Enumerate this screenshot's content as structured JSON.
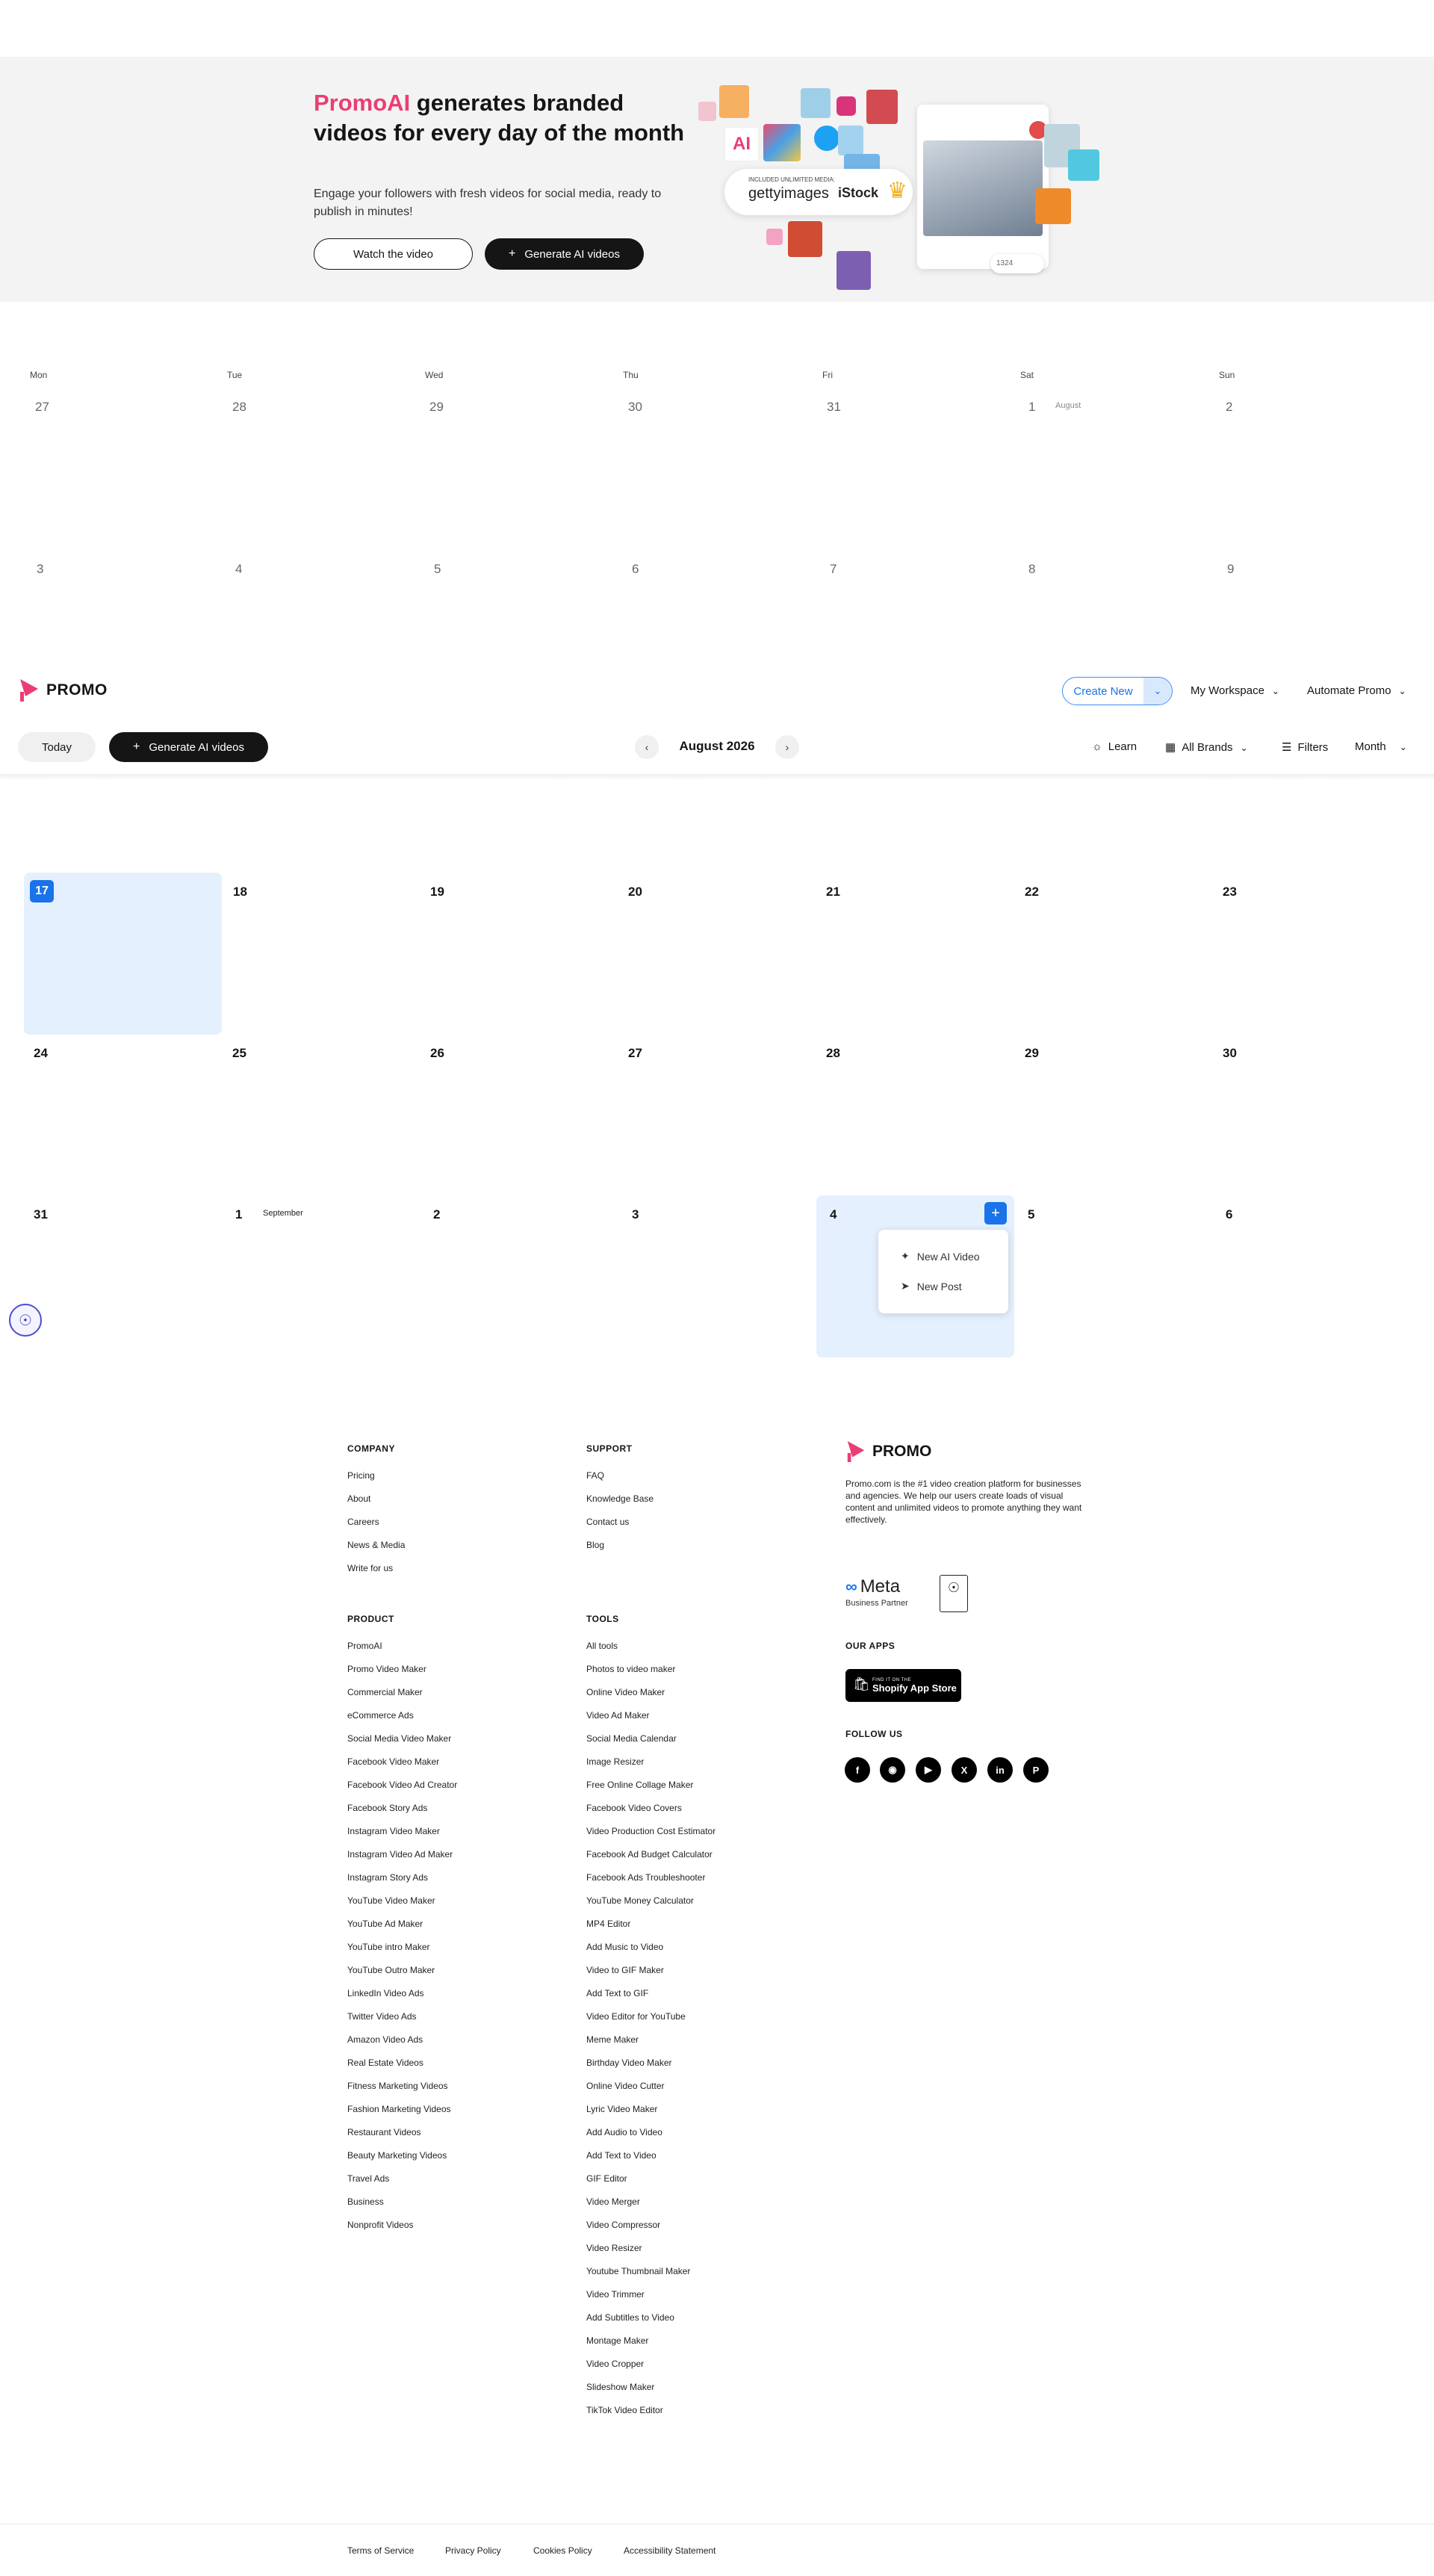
{
  "hero": {
    "title_brand": "PromoAI",
    "title_rest": " generates branded videos for every day of the month",
    "subtitle": "Engage your followers with fresh videos for social media, ready to publish in minutes!",
    "watch_label": "Watch the video",
    "generate_label": "Generate AI videos",
    "collage": {
      "included_label": "INCLUDED UNLIMITED MEDIA:",
      "getty": "gettyimages",
      "istock": "iStock",
      "ai_tile": "AI",
      "likes_count": "1324"
    }
  },
  "prev_calendar": {
    "weekdays": [
      "Mon",
      "Tue",
      "Wed",
      "Thu",
      "Fri",
      "Sat",
      "Sun"
    ],
    "row1": [
      "27",
      "28",
      "29",
      "30",
      "31",
      "1",
      "2"
    ],
    "row2": [
      "3",
      "4",
      "5",
      "6",
      "7",
      "8",
      "9"
    ],
    "month_label": "August"
  },
  "header": {
    "logo": "PROMO",
    "create_new": "Create New",
    "workspace": "My Workspace",
    "automate": "Automate Promo"
  },
  "toolbar": {
    "today": "Today",
    "generate": "Generate AI videos",
    "month_title": "August 2026",
    "learn": "Learn",
    "brands": "All Brands",
    "filters": "Filters",
    "view": "Month"
  },
  "calendar": {
    "row1": [
      "17",
      "18",
      "19",
      "20",
      "21",
      "22",
      "23"
    ],
    "row2": [
      "24",
      "25",
      "26",
      "27",
      "28",
      "29",
      "30"
    ],
    "row3": [
      "31",
      "1",
      "2",
      "3",
      "4",
      "5",
      "6"
    ],
    "september_label": "September",
    "today_date": "17",
    "popup": {
      "new_ai_video": "New AI Video",
      "new_post": "New Post"
    }
  },
  "footer": {
    "company_heading": "COMPANY",
    "company": [
      "Pricing",
      "About",
      "Careers",
      "News & Media",
      "Write for us"
    ],
    "support_heading": "SUPPORT",
    "support": [
      "FAQ",
      "Knowledge Base",
      "Contact us",
      "Blog"
    ],
    "product_heading": "PRODUCT",
    "product": [
      "PromoAI",
      "Promo Video Maker",
      "Commercial Maker",
      "eCommerce Ads",
      "Social Media Video Maker",
      "Facebook Video Maker",
      "Facebook Video Ad Creator",
      "Facebook Story Ads",
      "Instagram Video Maker",
      "Instagram Video Ad Maker",
      "Instagram Story Ads",
      "YouTube Video Maker",
      "YouTube Ad Maker",
      "YouTube intro Maker",
      "YouTube Outro Maker",
      "LinkedIn Video Ads",
      "Twitter Video Ads",
      "Amazon Video Ads",
      "Real Estate Videos",
      "Fitness Marketing Videos",
      "Fashion Marketing Videos",
      "Restaurant Videos",
      "Beauty Marketing Videos",
      "Travel Ads",
      "Business",
      "Nonprofit Videos"
    ],
    "tools_heading": "TOOLS",
    "tools": [
      "All tools",
      "Photos to video maker",
      "Online Video Maker",
      "Video Ad Maker",
      "Social Media Calendar",
      "Image Resizer",
      "Free Online Collage Maker",
      "Facebook Video Covers",
      "Video Production Cost Estimator",
      "Facebook Ad Budget Calculator",
      "Facebook Ads Troubleshooter",
      "YouTube Money Calculator",
      "MP4 Editor",
      "Add Music to Video",
      "Video to GIF Maker",
      "Add Text to GIF",
      "Video Editor for YouTube",
      "Meme Maker",
      "Birthday Video Maker",
      "Online Video Cutter",
      "Lyric Video Maker",
      "Add Audio to Video",
      "Add Text to Video",
      "GIF Editor",
      "Video Merger",
      "Video Compressor",
      "Video Resizer",
      "Youtube Thumbnail Maker",
      "Video Trimmer",
      "Add Subtitles to Video",
      "Montage Maker",
      "Video Cropper",
      "Slideshow Maker",
      "TikTok Video Editor"
    ],
    "logo": "PROMO",
    "description": "Promo.com is the #1 video creation platform for businesses and agencies. We help our users create loads of visual content and unlimited videos to promote anything they want effectively.",
    "meta_name": "Meta",
    "meta_sub": "Business Partner",
    "apps_heading": "OUR APPS",
    "shopify_small": "FIND IT ON THE",
    "shopify_big": "Shopify App Store",
    "follow_heading": "FOLLOW US",
    "social": [
      "facebook-icon",
      "instagram-icon",
      "youtube-icon",
      "x-icon",
      "linkedin-icon",
      "pinterest-icon"
    ],
    "bottom_links": [
      "Terms of Service",
      "Privacy Policy",
      "Cookies Policy",
      "Accessibility Statement"
    ]
  }
}
